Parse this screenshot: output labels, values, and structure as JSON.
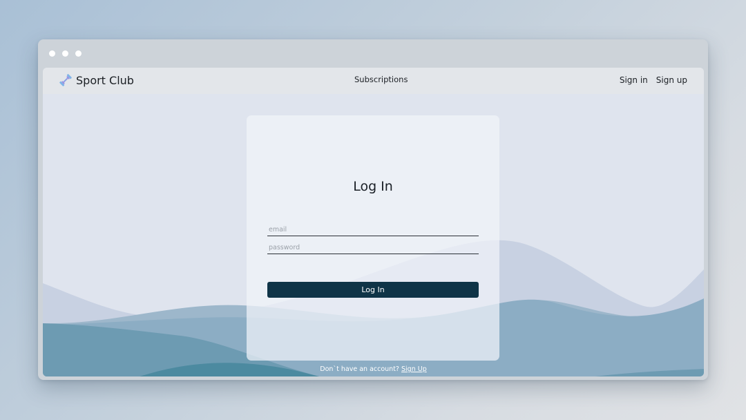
{
  "navbar": {
    "brand": "Sport Club",
    "links_center": [
      "Subscriptions"
    ],
    "links_right": [
      "Sign in",
      "Sign up"
    ]
  },
  "login": {
    "title": "Log In",
    "email_placeholder": "email",
    "password_placeholder": "password",
    "submit_label": "Log In"
  },
  "footer": {
    "prompt": "Don`t have an account?",
    "link": "Sign Up"
  },
  "icons": {
    "brand": "dumbbell-icon",
    "window_controls": [
      "window-dot-icon",
      "window-dot-icon",
      "window-dot-icon"
    ]
  },
  "colors": {
    "accent": "#0f3447",
    "card_bg": "#f1f4fa",
    "wave_light": "#c7d0e1",
    "wave_mid": "#8fafc5",
    "wave_dark": "#6b9ab0"
  }
}
